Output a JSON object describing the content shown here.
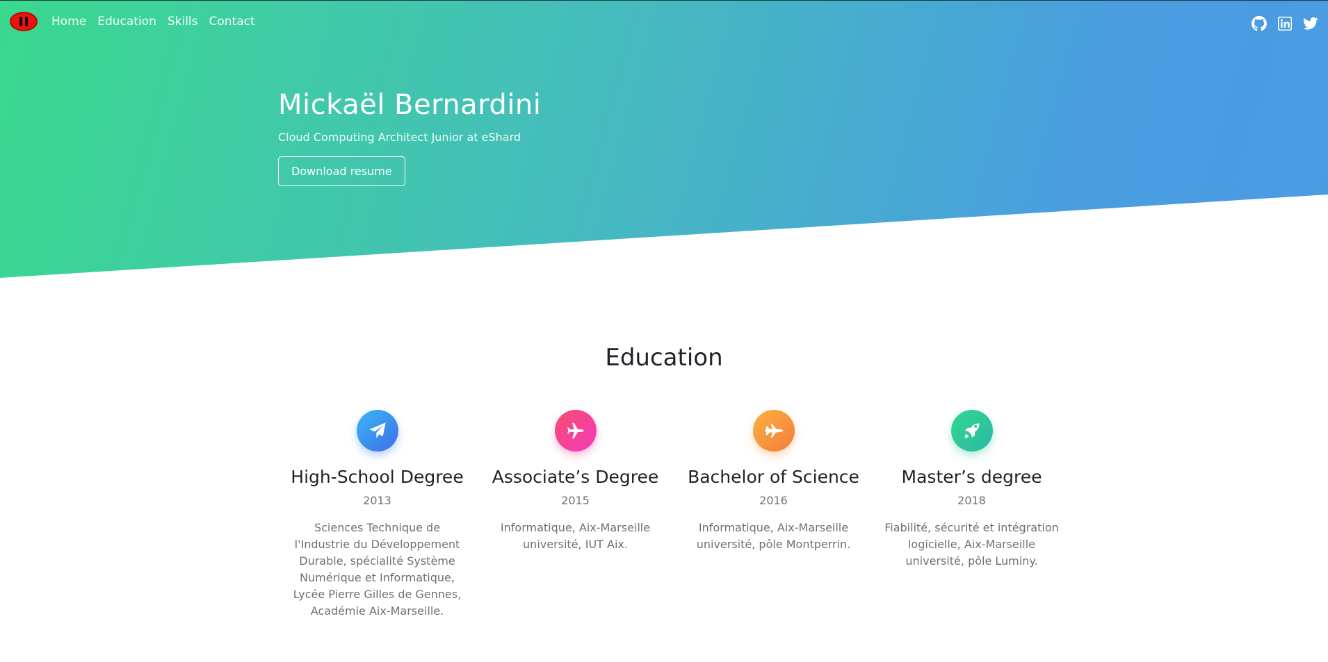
{
  "nav": {
    "logo": "pause-logo",
    "links": [
      "Home",
      "Education",
      "Skills",
      "Contact"
    ]
  },
  "social": {
    "icons": [
      "github-icon",
      "linkedin-icon",
      "twitter-icon"
    ]
  },
  "hero": {
    "name": "Mickaël Bernardini",
    "subtitle": "Cloud Computing Architect Junior at eShard",
    "button": "Download resume"
  },
  "education": {
    "title": "Education",
    "items": [
      {
        "icon": "paper-plane-icon",
        "color": "#3f7cec",
        "title": "High-School Degree",
        "year": "2013",
        "description": "Sciences Technique de l'Industrie du Développement Durable, spécialité Système Numérique et Informatique, Lycée Pierre Gilles de Gennes, Académie Aix-Marseille."
      },
      {
        "icon": "airplane-icon",
        "color": "#f5477f",
        "title": "Associate’s Degree",
        "year": "2015",
        "description": "Informatique, Aix-Marseille université, IUT Aix."
      },
      {
        "icon": "fighter-jet-icon",
        "color": "#f7973c",
        "title": "Bachelor of Science",
        "year": "2016",
        "description": "Informatique, Aix-Marseille université, pôle Montperrin."
      },
      {
        "icon": "rocket-icon",
        "color": "#2fc99a",
        "title": "Master’s degree",
        "year": "2018",
        "description": "Fiabilité, sécurité et intégration logicielle, Aix-Marseille université, pôle Luminy."
      }
    ]
  }
}
